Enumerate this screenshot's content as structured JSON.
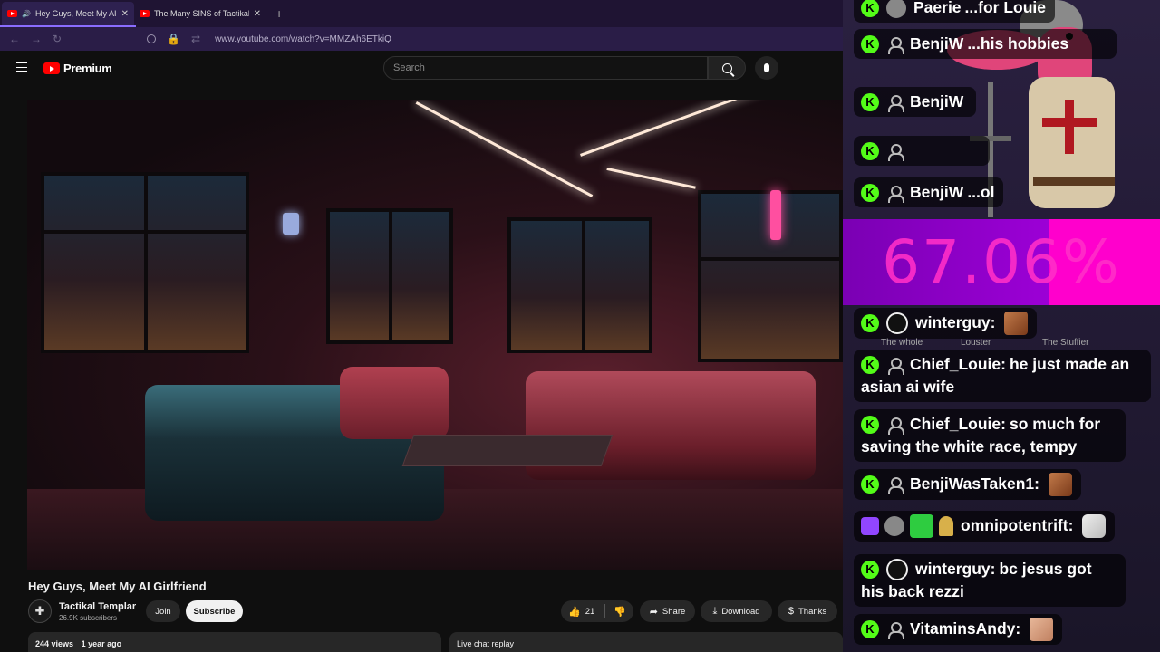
{
  "browser": {
    "tabs": [
      {
        "title": "Hey Guys, Meet My AI Girlf",
        "active": true
      },
      {
        "title": "The Many SINS of Tactikal Temp",
        "active": false
      }
    ],
    "new_tab": "+",
    "url": "www.youtube.com/watch?v=MMZAh6ETkiQ",
    "close_glyph": "✕"
  },
  "youtube": {
    "logo_text": "Premium",
    "search_placeholder": "Search",
    "video": {
      "title": "Hey Guys, Meet My AI Girlfriend",
      "channel": "Tactikal Templar",
      "subscribers": "26.9K subscribers",
      "join_label": "Join",
      "subscribe_label": "Subscribe",
      "likes": "21",
      "share_label": "Share",
      "download_label": "Download",
      "thanks_label": "Thanks",
      "more_glyph": "⋯",
      "views": "244 views",
      "age": "1 year ago",
      "live_chat_label": "Live chat replay"
    }
  },
  "overlay": {
    "percent": "67.06%",
    "messages": [
      {
        "user": "Paerie",
        "text": "...for Louie"
      },
      {
        "user": "BenjiW",
        "text": "...his hobbies"
      },
      {
        "user": "BenjiW",
        "text": ""
      },
      {
        "user": "",
        "text": ""
      },
      {
        "user": "BenjiW",
        "text": "...ol"
      },
      {
        "user": "winterguy:",
        "text": ""
      },
      {
        "user": "Chief_Louie:",
        "text": "he just made an asian ai wife"
      },
      {
        "user": "Chief_Louie:",
        "text": "so much for saving the white race, tempy"
      },
      {
        "user": "BenjiWasTaken1:",
        "text": ""
      },
      {
        "user": "omnipotentrift:",
        "text": ""
      },
      {
        "user": "winterguy:",
        "text": "bc jesus got his back rezzi"
      },
      {
        "user": "VitaminsAndy:",
        "text": ""
      }
    ],
    "behind_labels": [
      "The whole",
      "Louster",
      "The Stuffier"
    ],
    "colors": {
      "kick": "#53fc18",
      "twitch": "#9146ff",
      "percent_fill": "#ff00cc"
    }
  }
}
